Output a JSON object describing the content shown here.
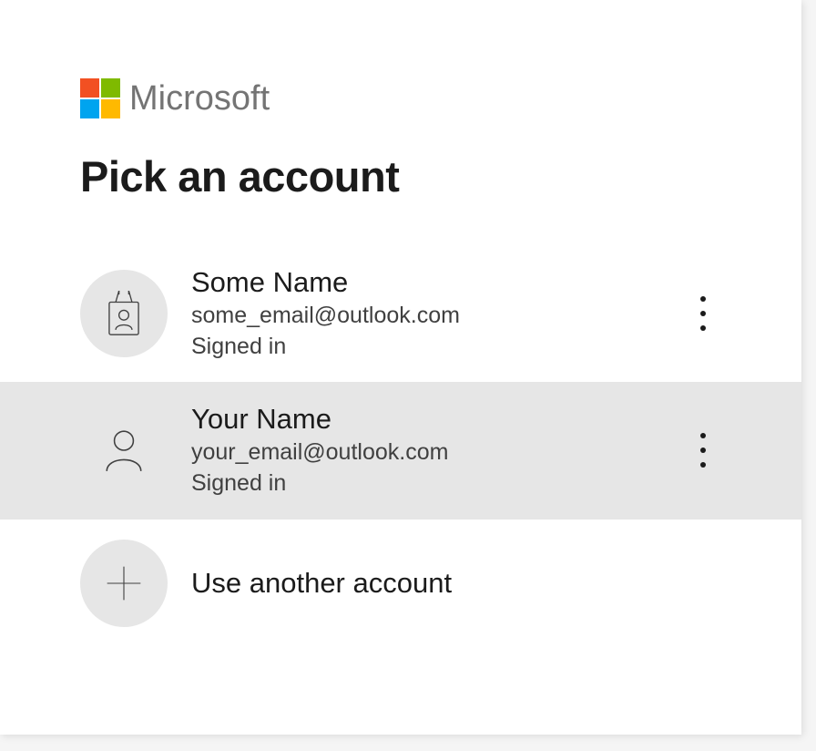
{
  "brand": {
    "name": "Microsoft"
  },
  "title": "Pick an account",
  "accounts": [
    {
      "display_name": "Some Name",
      "email": "some_email@outlook.com",
      "status": "Signed in",
      "icon": "badge",
      "highlighted": false
    },
    {
      "display_name": "Your Name",
      "email": "your_email@outlook.com",
      "status": "Signed in",
      "icon": "person",
      "highlighted": true
    }
  ],
  "another_label": "Use another account"
}
